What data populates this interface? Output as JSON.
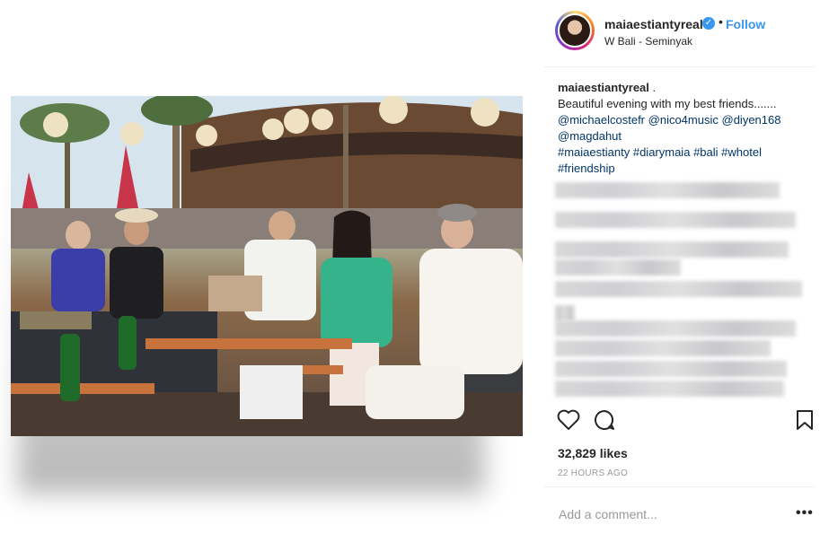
{
  "post": {
    "username": "maiaestiantyreal",
    "verified_icon": "verified-badge-icon",
    "separator": "•",
    "follow_label": "Follow",
    "location": "W Bali - Seminyak"
  },
  "caption": {
    "username": "maiaestiantyreal",
    "after_user": ".",
    "text": "Beautiful evening with my best friends.......",
    "mentions": [
      "@michaelcostefr",
      "@nico4music",
      "@diyen168",
      "@magdahut"
    ],
    "hashtags": [
      "#maiaestianty",
      "#diarymaia",
      "#bali",
      "#whotel",
      "#friendship"
    ]
  },
  "stats": {
    "likes": "32,829 likes",
    "time": "22 HOURS AGO"
  },
  "comment": {
    "placeholder": "Add a comment...",
    "more_label": "•••"
  },
  "icons": {
    "like": "heart-icon",
    "comment": "comment-bubble-icon",
    "save": "bookmark-icon",
    "verified": "verified-check-icon"
  },
  "colors": {
    "link": "#003569",
    "follow": "#3897f0",
    "muted": "#999999",
    "text": "#262626"
  }
}
